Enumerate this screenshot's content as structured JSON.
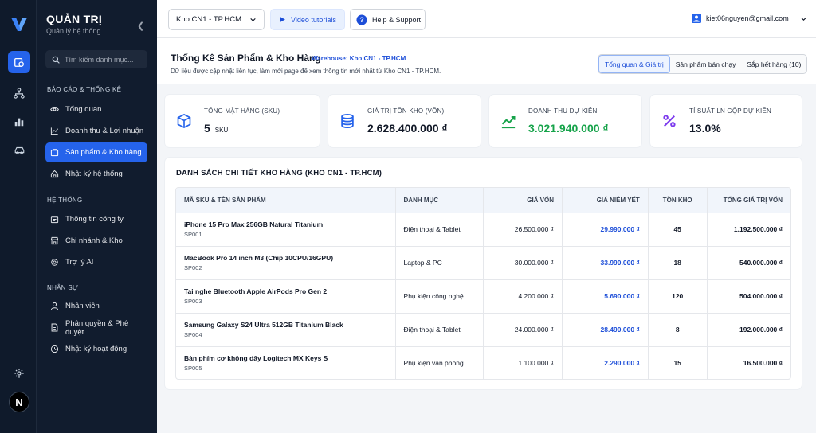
{
  "app": {
    "title": "QUẢN TRỊ",
    "subtitle": "Quản lý hệ thống",
    "avatar_letter": "N"
  },
  "sidebar": {
    "search_placeholder": "Tìm kiếm danh mục...",
    "sections": [
      {
        "title": "BÁO CÁO & THỐNG KÊ",
        "items": [
          {
            "label": "Tổng quan",
            "icon": "eye-icon"
          },
          {
            "label": "Doanh thu & Lợi nhuận",
            "icon": "line-chart-icon"
          },
          {
            "label": "Sản phẩm & Kho hàng",
            "icon": "cart-icon",
            "active": true
          },
          {
            "label": "Nhật ký hệ thống",
            "icon": "house-icon"
          }
        ]
      },
      {
        "title": "HỆ THỐNG",
        "items": [
          {
            "label": "Thông tin công ty",
            "icon": "company-icon"
          },
          {
            "label": "Chi nhánh & Kho",
            "icon": "store-icon"
          },
          {
            "label": "Trợ lý AI",
            "icon": "gear-icon"
          }
        ]
      },
      {
        "title": "NHÂN SỰ",
        "items": [
          {
            "label": "Nhân viên",
            "icon": "user-icon"
          },
          {
            "label": "Phân quyền & Phê duyệt",
            "icon": "document-icon"
          },
          {
            "label": "Nhật ký hoạt động",
            "icon": "clock-icon"
          }
        ]
      }
    ]
  },
  "topbar": {
    "branch_select": "Kho CN1 - TP.HCM",
    "video_label": "Video tutorials",
    "help_label": "Help & Support",
    "user_email": "kiet06nguyen@gmail.com"
  },
  "header": {
    "title": "Thống Kê Sản Phẩm & Kho Hàng",
    "warehouse": "Warehouse: Kho CN1 - TP.HCM",
    "description": "Dữ liệu được cập nhật liên tục, làm mới page để xem thông tin mới nhất từ Kho CN1 - TP.HCM.",
    "tabs": [
      {
        "label": "Tổng quan & Giá trị",
        "active": true
      },
      {
        "label": "Sản phẩm bán chạy"
      },
      {
        "label": "Sắp hết hàng (10)"
      }
    ]
  },
  "stats": [
    {
      "label": "TỔNG MẶT HÀNG (SKU)",
      "value": "5",
      "unit": "SKU",
      "icon": "box-icon",
      "color": "#2563eb"
    },
    {
      "label": "GIÁ TRỊ TỒN KHO (VỐN)",
      "value": "2.628.400.000 ₫",
      "icon": "database-icon",
      "color": "#2563eb"
    },
    {
      "label": "DOANH THU DỰ KIẾN",
      "value": "3.021.940.000 ₫",
      "icon": "trend-up-icon",
      "color": "#16a34a"
    },
    {
      "label": "TỈ SUẤT LN GỘP DỰ KIẾN",
      "value": "13.0%",
      "icon": "percent-icon",
      "color": "#7c3aed"
    }
  ],
  "table": {
    "title": "DANH SÁCH CHI TIẾT KHO HÀNG (KHO CN1 - TP.HCM)",
    "columns": [
      "MÃ SKU & TÊN SẢN PHẨM",
      "DANH MỤC",
      "GIÁ VỐN",
      "GIÁ NIÊM YẾT",
      "TỒN KHO",
      "TỔNG GIÁ TRỊ VỐN"
    ],
    "rows": [
      {
        "name": "iPhone 15 Pro Max 256GB Natural Titanium",
        "sku": "SP001",
        "category": "Điện thoại & Tablet",
        "cost": "26.500.000 ₫",
        "price": "29.990.000 ₫",
        "stock": "45",
        "total": "1.192.500.000 ₫"
      },
      {
        "name": "MacBook Pro 14 inch M3 (Chip 10CPU/16GPU)",
        "sku": "SP002",
        "category": "Laptop & PC",
        "cost": "30.000.000 ₫",
        "price": "33.990.000 ₫",
        "stock": "18",
        "total": "540.000.000 ₫"
      },
      {
        "name": "Tai nghe Bluetooth Apple AirPods Pro Gen 2",
        "sku": "SP003",
        "category": "Phụ kiện công nghệ",
        "cost": "4.200.000 ₫",
        "price": "5.690.000 ₫",
        "stock": "120",
        "total": "504.000.000 ₫"
      },
      {
        "name": "Samsung Galaxy S24 Ultra 512GB Titanium Black",
        "sku": "SP004",
        "category": "Điện thoại & Tablet",
        "cost": "24.000.000 ₫",
        "price": "28.490.000 ₫",
        "stock": "8",
        "total": "192.000.000 ₫"
      },
      {
        "name": "Bàn phím cơ không dây Logitech MX Keys S",
        "sku": "SP005",
        "category": "Phụ kiện văn phòng",
        "cost": "1.100.000 ₫",
        "price": "2.290.000 ₫",
        "stock": "15",
        "total": "16.500.000 ₫"
      }
    ]
  }
}
